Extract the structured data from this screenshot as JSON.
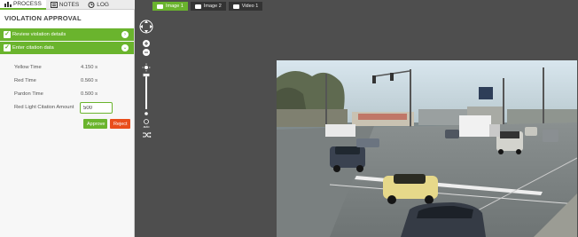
{
  "left_tabs": [
    {
      "label": "PROCESS",
      "icon": "process-icon",
      "active": true
    },
    {
      "label": "NOTES",
      "icon": "notes-icon",
      "active": false
    },
    {
      "label": "LOG",
      "icon": "log-icon",
      "active": false
    }
  ],
  "panel": {
    "title": "VIOLATION APPROVAL",
    "steps": [
      {
        "label": "Review violation details"
      },
      {
        "label": "Enter citation data"
      }
    ],
    "fields": [
      {
        "label": "Yellow Time",
        "value": "4.150 s"
      },
      {
        "label": "Red Time",
        "value": "0.560 s"
      },
      {
        "label": "Pardon Time",
        "value": "0.500 s"
      }
    ],
    "citation": {
      "label": "Red Light Citation Amount",
      "value": "500"
    },
    "approve_label": "Approve",
    "reject_label": "Reject"
  },
  "media_tabs": [
    {
      "label": "Image 1",
      "icon": "camera-icon",
      "active": true
    },
    {
      "label": "Image 2",
      "icon": "camera-icon",
      "active": false
    },
    {
      "label": "Video 1",
      "icon": "video-icon",
      "active": false
    }
  ],
  "toolbar": {
    "auto_label": "auto",
    "icons": [
      "pan-icon",
      "zoom-in-icon",
      "zoom-out-icon",
      "brightness-icon",
      "contrast-icon",
      "shuffle-icon"
    ]
  },
  "colors": {
    "accent": "#6ab42d",
    "reject": "#e94e1b",
    "viewer_bg": "#4e4e4e"
  }
}
